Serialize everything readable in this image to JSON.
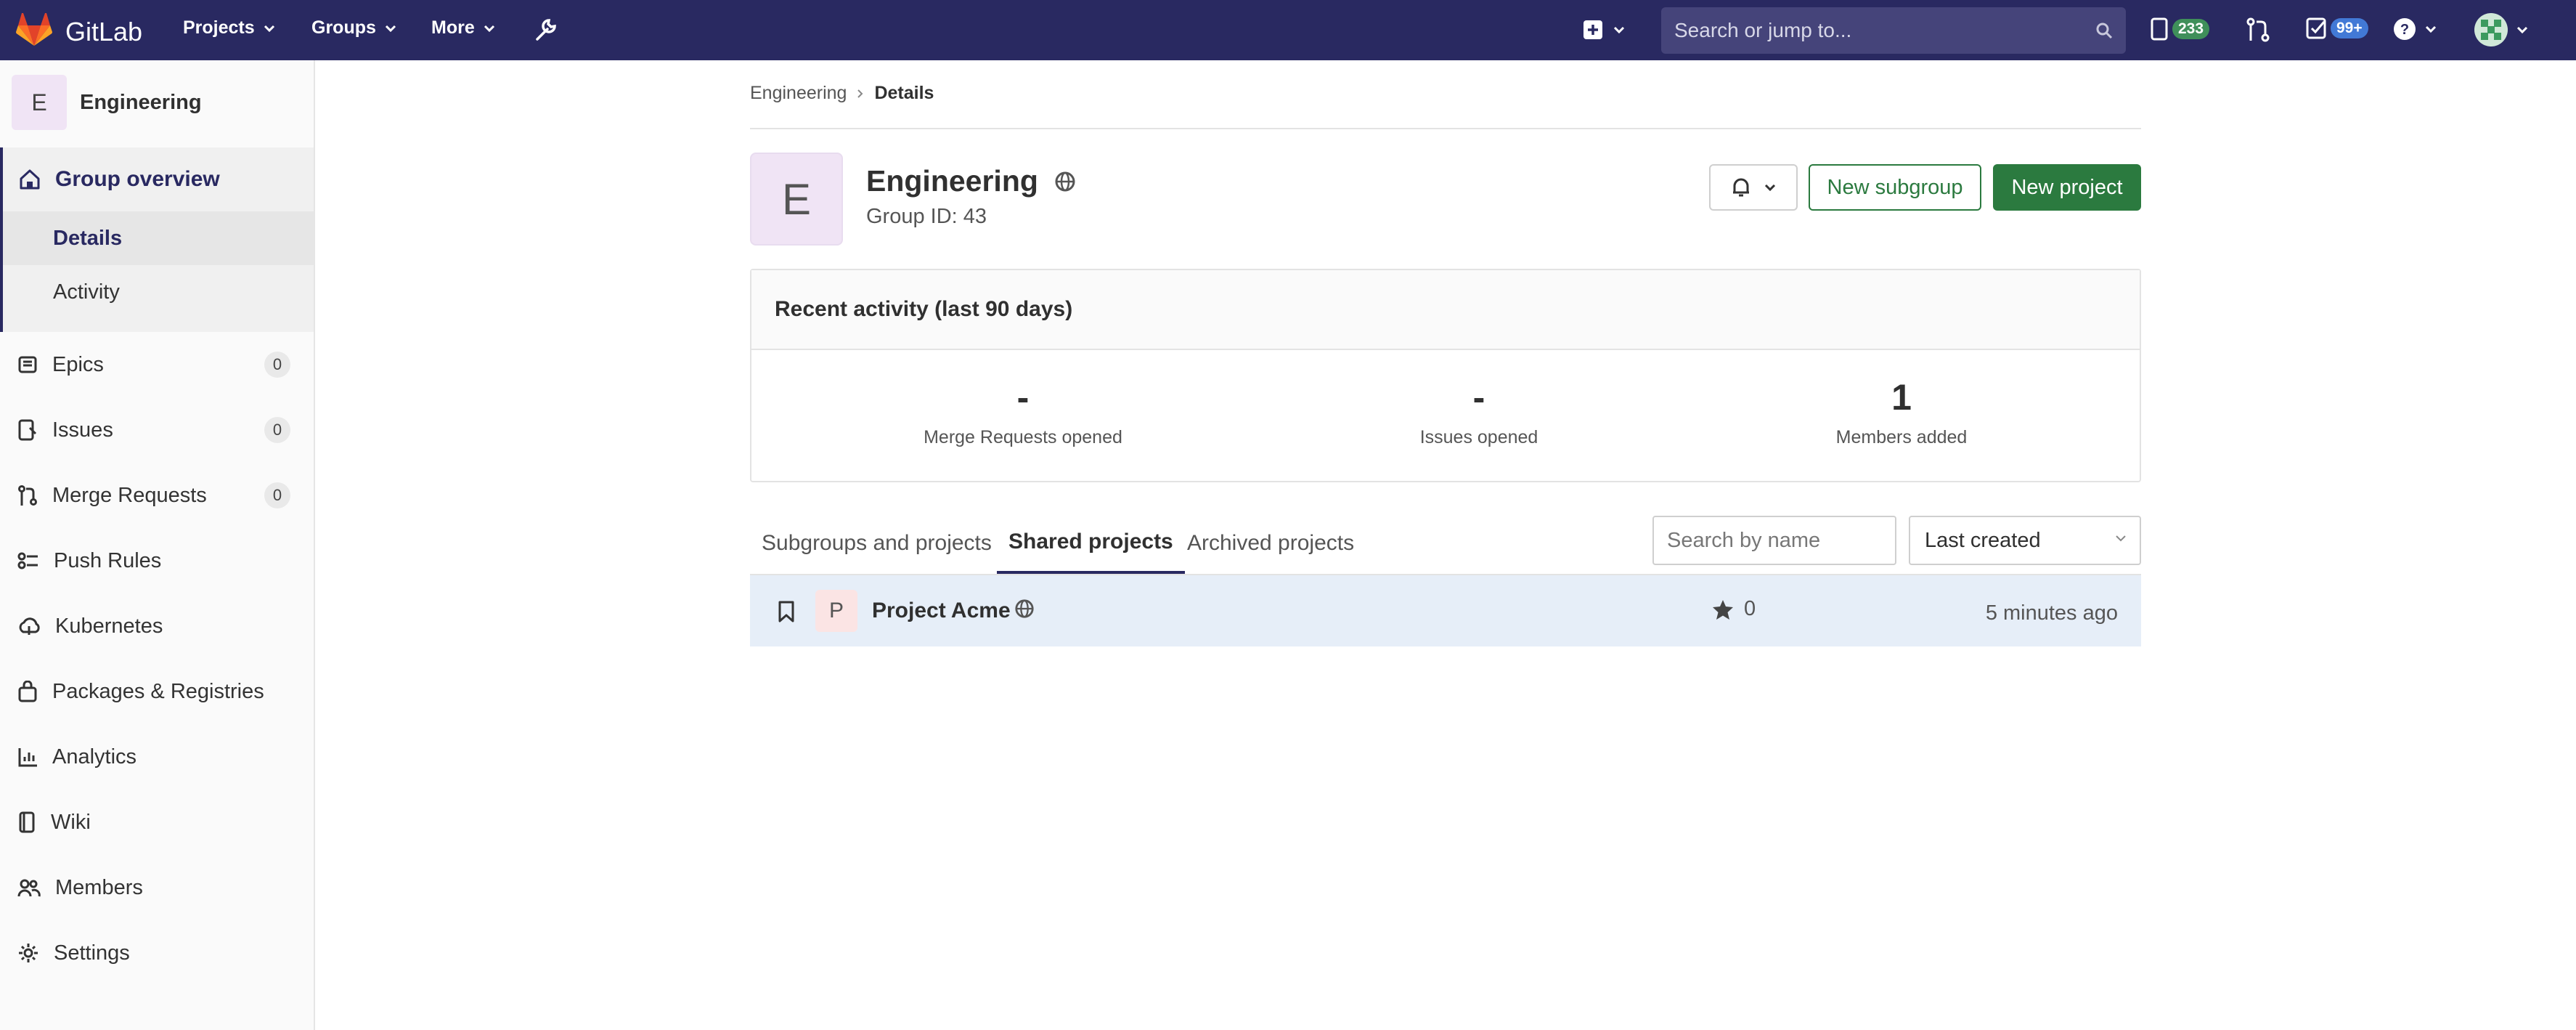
{
  "topbar": {
    "brand": "GitLab",
    "nav": [
      "Projects",
      "Groups",
      "More"
    ],
    "search_placeholder": "Search or jump to...",
    "issues_count": "233",
    "todos_count": "99+"
  },
  "sidebar": {
    "context_initial": "E",
    "context_name": "Engineering",
    "section": {
      "label": "Group overview",
      "items": [
        "Details",
        "Activity"
      ]
    },
    "items": [
      {
        "label": "Epics",
        "count": "0"
      },
      {
        "label": "Issues",
        "count": "0"
      },
      {
        "label": "Merge Requests",
        "count": "0"
      },
      {
        "label": "Push Rules"
      },
      {
        "label": "Kubernetes"
      },
      {
        "label": "Packages & Registries"
      },
      {
        "label": "Analytics"
      },
      {
        "label": "Wiki"
      },
      {
        "label": "Members"
      },
      {
        "label": "Settings"
      }
    ]
  },
  "breadcrumb": {
    "parent": "Engineering",
    "current": "Details"
  },
  "group": {
    "initial": "E",
    "name": "Engineering",
    "id_text": "Group ID: 43"
  },
  "actions": {
    "new_subgroup": "New subgroup",
    "new_project": "New project"
  },
  "activity": {
    "title": "Recent activity (last 90 days)",
    "stats": [
      {
        "value": "-",
        "label": "Merge Requests opened"
      },
      {
        "value": "-",
        "label": "Issues opened"
      },
      {
        "value": "1",
        "label": "Members added"
      }
    ]
  },
  "tabs": [
    "Subgroups and projects",
    "Shared projects",
    "Archived projects"
  ],
  "filter": {
    "placeholder": "Search by name",
    "sort": "Last created"
  },
  "projects": [
    {
      "initial": "P",
      "name": "Project Acme",
      "stars": "0",
      "updated": "5 minutes ago"
    }
  ]
}
